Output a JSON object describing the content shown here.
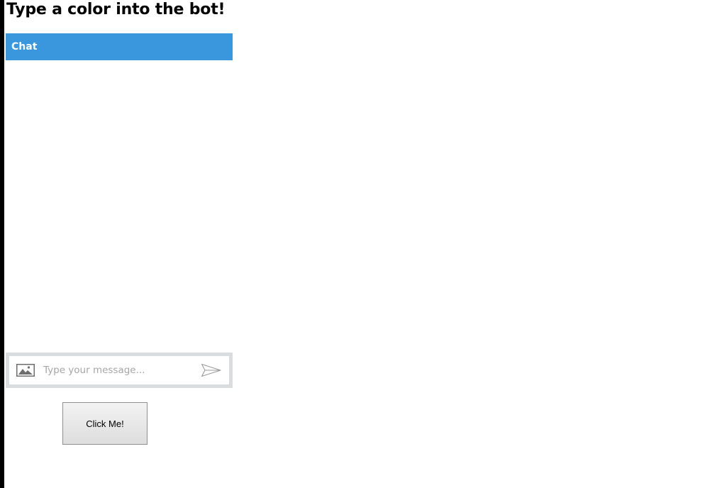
{
  "page": {
    "title": "Type a color into the bot!"
  },
  "chat": {
    "header_label": "Chat",
    "header_color": "#3a96dd",
    "input": {
      "placeholder": "Type your message...",
      "value": ""
    },
    "icons": {
      "upload": "image-icon",
      "send": "send-icon"
    }
  },
  "actions": {
    "click_button_label": "Click Me!"
  }
}
